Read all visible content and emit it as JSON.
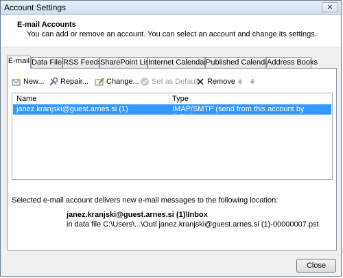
{
  "window": {
    "title": "Account Settings",
    "close_glyph": "✕"
  },
  "header": {
    "title": "E-mail Accounts",
    "subtitle": "You can add or remove an account. You can select an account and change its settings."
  },
  "tabs": [
    "E-mail",
    "Data Files",
    "RSS Feeds",
    "SharePoint Lists",
    "Internet Calendars",
    "Published Calendars",
    "Address Books"
  ],
  "toolbar": {
    "new_label": "New...",
    "repair_label": "Repair...",
    "change_label": "Change...",
    "default_label": "Set as Default",
    "remove_label": "Remove"
  },
  "list": {
    "columns": {
      "name": "Name",
      "type": "Type"
    },
    "rows": [
      {
        "name": "janez.kranjski@guest.arnes.si (1)",
        "type": "IMAP/SMTP (send from this account by default)"
      }
    ]
  },
  "delivery": {
    "label": "Selected e-mail account delivers new e-mail messages to the following location:",
    "mailbox": "janez.kranjski@guest.arnes.si (1)\\Inbox",
    "file": "in data file C:\\Users\\...\\Outl janez.kranjski@guest.arnes.si (1)-00000007.pst"
  },
  "footer": {
    "close_label": "Close"
  },
  "colors": {
    "selection": "#3399ff",
    "title_bar": "#dbe7f4"
  }
}
